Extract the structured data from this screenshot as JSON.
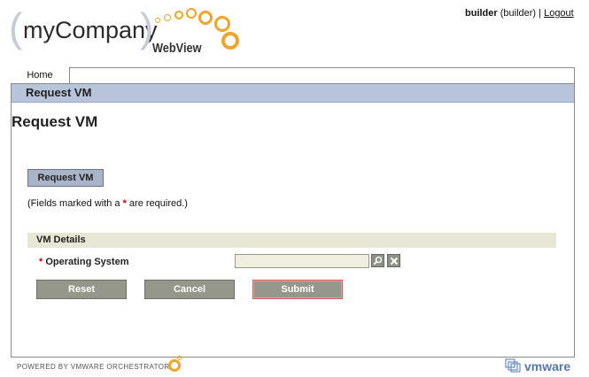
{
  "header": {
    "logo_paren_open": "(",
    "logo_brand": "myCompany",
    "logo_paren_close": ")",
    "logo_sub": "WebView",
    "user_name": "builder",
    "user_role": "(builder)",
    "separator": "|",
    "logout_label": "Logout"
  },
  "nav": {
    "home_tab": "Home",
    "section_bar": "Request VM"
  },
  "main": {
    "page_title": "Request VM",
    "tab_button": "Request VM",
    "required_note_prefix": "(Fields marked with a ",
    "required_star": "*",
    "required_note_suffix": " are required.)",
    "section_title": "VM Details",
    "field_required_star": "*",
    "field_label": "Operating System",
    "field_value": "",
    "buttons": {
      "reset": "Reset",
      "cancel": "Cancel",
      "submit": "Submit"
    }
  },
  "footer": {
    "powered_by": "POWERED BY VMWARE ORCHESTRATOR",
    "vmware_logo_text": "vmware"
  },
  "colors": {
    "accent_orange": "#f0a52a",
    "nav_bar": "#b8c4d9",
    "section_bar": "#e8e7d6",
    "button_gray": "#95978a",
    "required_red": "#c00000"
  },
  "icons": {
    "search": "search-icon",
    "clear": "close-icon",
    "orchestrator_logo": "orchestrator-ring-icon",
    "vmware_logo": "vmware-logo-icon"
  }
}
